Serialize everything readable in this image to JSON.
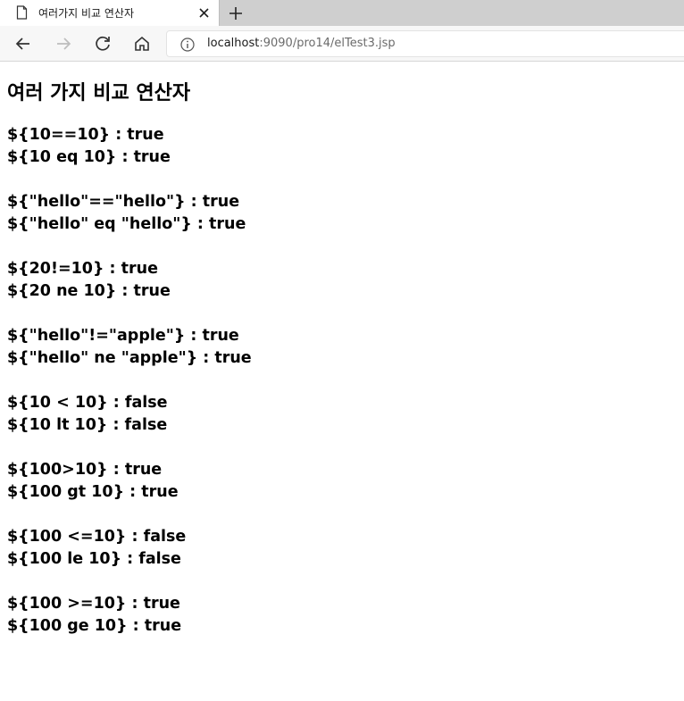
{
  "browser": {
    "tab_title": "여러가지 비교 연산자",
    "url_host": "localhost",
    "url_rest": ":9090/pro14/elTest3.jsp"
  },
  "page": {
    "heading": "여러 가지 비교 연산자",
    "groups": [
      [
        "${10==10} : true",
        "${10 eq 10} : true"
      ],
      [
        "${\"hello\"==\"hello\"} : true",
        "${\"hello\" eq \"hello\"} : true"
      ],
      [
        "${20!=10} : true",
        "${20 ne 10} : true"
      ],
      [
        "${\"hello\"!=\"apple\"} : true",
        "${\"hello\" ne \"apple\"} : true"
      ],
      [
        "${10 < 10} : false",
        "${10 lt 10} : false"
      ],
      [
        "${100>10} : true",
        "${100 gt 10} : true"
      ],
      [
        "${100 <=10} : false",
        "${100 le 10} : false"
      ],
      [
        "${100 >=10} : true",
        "${100 ge 10} : true"
      ]
    ]
  }
}
